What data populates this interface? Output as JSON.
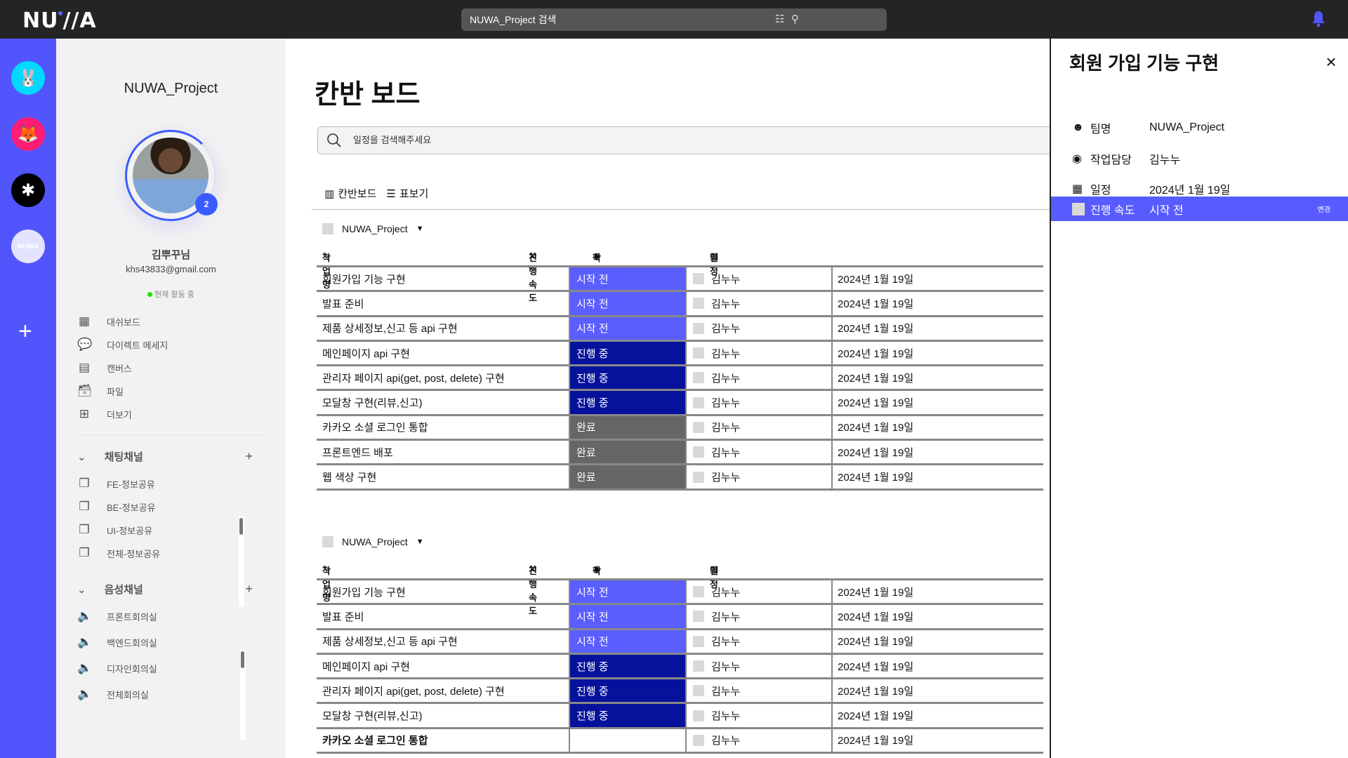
{
  "topbar": {
    "logo": "NUWA",
    "search_placeholder": "NUWA_Project 검색",
    "icons": [
      "filter-sliders-icon",
      "search-icon",
      "bell-icon"
    ],
    "bell_color": "#5255fc"
  },
  "rail": {
    "servers": [
      {
        "name": "pancake-bunny",
        "color": "#00d9ff",
        "glyph": "🐰"
      },
      {
        "name": "shiba-fox",
        "color": "#ff1d74",
        "glyph": "🦊"
      },
      {
        "name": "black-logo",
        "color": "#000000",
        "glyph": "✱"
      },
      {
        "name": "nuwa",
        "color": "#e3e3ff",
        "glyph": "NUWA"
      }
    ],
    "add": "+",
    "bg": "#5255fc"
  },
  "sidebar": {
    "title": "NUWA_Project",
    "badge": "2",
    "user_name": "김뿌꾸님",
    "email": "khs43833@gmail.com",
    "status": "현재 활동 중",
    "menu": [
      {
        "label": "대쉬보드",
        "icon": "dashboard-icon",
        "glyph": "▦"
      },
      {
        "label": "다이렉트 메세지",
        "icon": "chat-bubble-icon",
        "glyph": "💬"
      },
      {
        "label": "캔버스",
        "icon": "document-icon",
        "glyph": "▤"
      },
      {
        "label": "파일",
        "icon": "inbox-icon",
        "glyph": "🗃"
      },
      {
        "label": "더보기",
        "icon": "plus-square-icon",
        "glyph": "⊞"
      }
    ],
    "chat_section": "채팅채널",
    "chat_channels": [
      "FE-정보공유",
      "BE-정보공유",
      "UI-정보공유",
      "전체-정보공유"
    ],
    "voice_section": "음성채널",
    "voice_channels": [
      "프론트회의실",
      "백엔드회의실",
      "디자인회의실",
      "전체회의실"
    ],
    "plus": "+"
  },
  "main": {
    "title": "칸반 보드",
    "search_placeholder": "일정을 검색해주세요",
    "views": [
      "칸반보드",
      "표보기"
    ],
    "columns": [
      "작업명",
      "진행 속도",
      "작업담당",
      "일정"
    ],
    "status_colors": {
      "시작 전": "#5a5eff",
      "진행 중": "#06129c",
      "완료": "#666666",
      "": "#ffffff"
    },
    "groups": [
      {
        "name": "NUWA_Project",
        "rows": [
          {
            "task": "회원가입 기능 구현",
            "status": "시작 전",
            "assignee": "김누누",
            "date": "2024년 1월 19일"
          },
          {
            "task": "발표 준비",
            "status": "시작 전",
            "assignee": "김누누",
            "date": "2024년 1월 19일"
          },
          {
            "task": "제품 상세정보,신고 등 api 구현",
            "status": "시작 전",
            "assignee": "김누누",
            "date": "2024년 1월 19일"
          },
          {
            "task": "메인페이지 api 구현",
            "status": "진행 중",
            "assignee": "김누누",
            "date": "2024년 1월 19일"
          },
          {
            "task": "관리자 페이지 api(get, post, delete) 구현",
            "status": "진행 중",
            "assignee": "김누누",
            "date": "2024년 1월 19일"
          },
          {
            "task": "모달창 구현(리뷰,신고)",
            "status": "진행 중",
            "assignee": "김누누",
            "date": "2024년 1월 19일"
          },
          {
            "task": "카카오 소셜 로그인 통합",
            "status": "완료",
            "assignee": "김누누",
            "date": "2024년 1월 19일"
          },
          {
            "task": "프론트엔드 배포",
            "status": "완료",
            "assignee": "김누누",
            "date": "2024년 1월 19일"
          },
          {
            "task": "웹 색상 구현",
            "status": "완료",
            "assignee": "김누누",
            "date": "2024년 1월 19일"
          }
        ]
      },
      {
        "name": "NUWA_Project",
        "rows": [
          {
            "task": "회원가입 기능 구현",
            "status": "시작 전",
            "assignee": "김누누",
            "date": "2024년 1월 19일"
          },
          {
            "task": "발표 준비",
            "status": "시작 전",
            "assignee": "김누누",
            "date": "2024년 1월 19일"
          },
          {
            "task": "제품 상세정보,신고 등 api 구현",
            "status": "시작 전",
            "assignee": "김누누",
            "date": "2024년 1월 19일"
          },
          {
            "task": "메인페이지 api 구현",
            "status": "진행 중",
            "assignee": "김누누",
            "date": "2024년 1월 19일"
          },
          {
            "task": "관리자 페이지 api(get, post, delete) 구현",
            "status": "진행 중",
            "assignee": "김누누",
            "date": "2024년 1월 19일"
          },
          {
            "task": "모달창 구현(리뷰,신고)",
            "status": "진행 중",
            "assignee": "김누누",
            "date": "2024년 1월 19일"
          },
          {
            "task": "카카오 소셜 로그인 통합",
            "status": "",
            "assignee": "김누누",
            "date": "2024년 1월 19일",
            "bold": true
          }
        ]
      }
    ]
  },
  "panel": {
    "title": "회원 가입 기능 구현",
    "close": "×",
    "team_label": "팀명",
    "team": "NUWA_Project",
    "assignee_label": "작업담당",
    "assignee": "김누누",
    "date_label": "일정",
    "date": "2024년 1월 19일",
    "progress_label": "진행 속도",
    "progress": "시작 전",
    "edit": "변경",
    "highlight_color": "#585cff"
  }
}
